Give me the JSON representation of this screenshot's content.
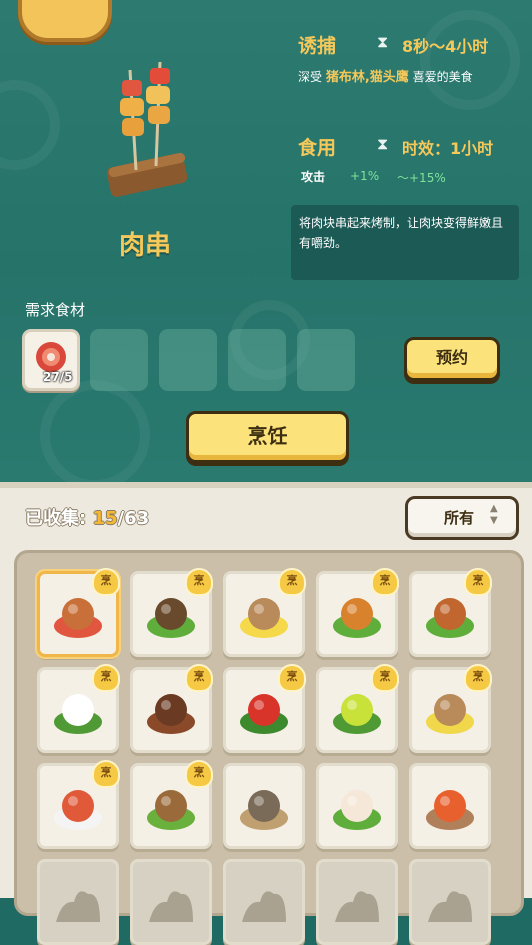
{
  "recipe": {
    "name": "肉串",
    "lure": {
      "title": "诱捕",
      "duration": "8秒～4小时",
      "desc_prefix": "深受",
      "desc_animals": "猪布林,猫头鹰",
      "desc_suffix": "喜爱的美食"
    },
    "eat": {
      "title": "食用",
      "duration": "时效：1小时",
      "stat_label": "攻击",
      "stat_min": "+1%",
      "stat_max": "～+15%"
    },
    "description": "将肉块串起来烤制，让肉块变得鲜嫩且有嚼劲。"
  },
  "ingredients": {
    "label": "需求食材",
    "slots": [
      {
        "icon": "raw-meat-icon",
        "count": "27/5"
      }
    ],
    "empty_slots": 4
  },
  "buttons": {
    "reserve": "预约",
    "cook": "烹饪"
  },
  "collection": {
    "label": "已收集:",
    "collected": "15",
    "total": "/63",
    "filter": "所有",
    "cook_badge": "烹",
    "items": [
      {
        "icon": "meat-skewer-icon",
        "cooked": true,
        "selected": true
      },
      {
        "icon": "veggie-skewer-icon",
        "cooked": true
      },
      {
        "icon": "egg-pudding-cup-icon",
        "cooked": true
      },
      {
        "icon": "roast-drumstick-icon",
        "cooked": true
      },
      {
        "icon": "roast-ham-icon",
        "cooked": true
      },
      {
        "icon": "fried-eggs-icon",
        "cooked": true
      },
      {
        "icon": "mushroom-skewer-icon",
        "cooked": true
      },
      {
        "icon": "chili-peppers-icon",
        "cooked": true
      },
      {
        "icon": "green-fruits-icon",
        "cooked": true
      },
      {
        "icon": "lemon-cup-icon",
        "cooked": true
      },
      {
        "icon": "seafood-plate-icon",
        "cooked": true
      },
      {
        "icon": "veggie-bowl-icon",
        "cooked": true
      },
      {
        "icon": "fish-skewer-icon",
        "cooked": false
      },
      {
        "icon": "scallop-plate-icon",
        "cooked": false
      },
      {
        "icon": "shrimp-skewer-icon",
        "cooked": false
      },
      {
        "icon": "locked-silhouette-icon",
        "locked": true
      },
      {
        "icon": "locked-silhouette-icon",
        "locked": true
      },
      {
        "icon": "locked-silhouette-icon",
        "locked": true
      },
      {
        "icon": "locked-silhouette-icon",
        "locked": true
      },
      {
        "icon": "locked-silhouette-icon",
        "locked": true
      }
    ]
  }
}
